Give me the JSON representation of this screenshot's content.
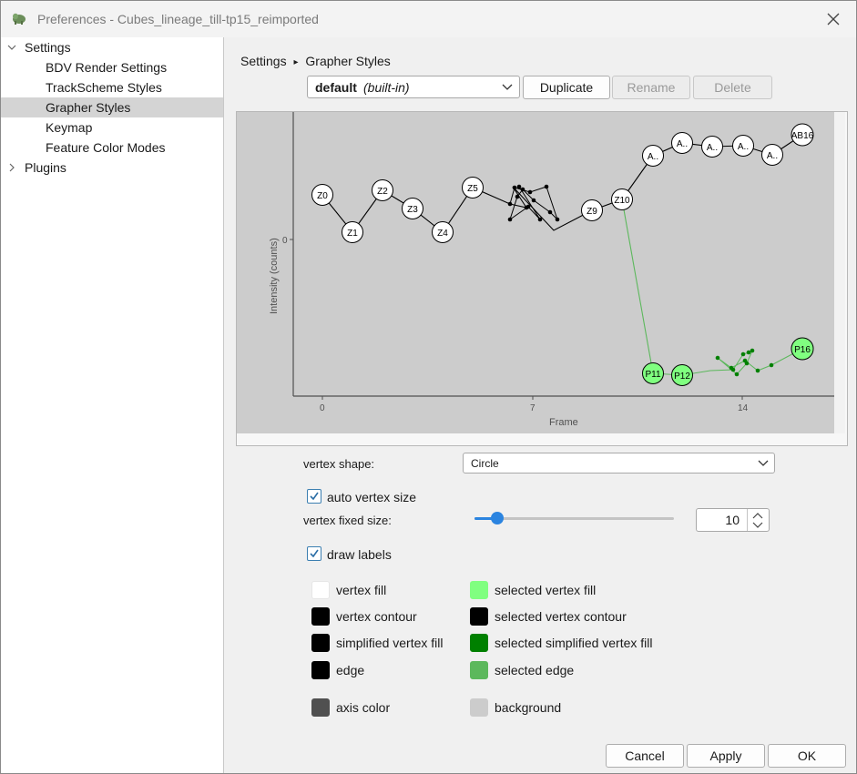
{
  "window": {
    "title": "Preferences - Cubes_lineage_till-tp15_reimported"
  },
  "sidebar": {
    "items": [
      {
        "label": "Settings"
      },
      {
        "label": "BDV Render Settings"
      },
      {
        "label": "TrackScheme Styles"
      },
      {
        "label": "Grapher Styles",
        "selected": true
      },
      {
        "label": "Keymap"
      },
      {
        "label": "Feature Color Modes"
      },
      {
        "label": "Plugins"
      }
    ]
  },
  "breadcrumb": {
    "root": "Settings",
    "separator": "▸",
    "current": "Grapher Styles"
  },
  "style_selector": {
    "name": "default",
    "suffix": "(built-in)"
  },
  "buttons": {
    "duplicate": "Duplicate",
    "rename": "Rename",
    "delete": "Delete"
  },
  "preview": {
    "ylabel": "Intensity (counts)",
    "xlabel": "Frame",
    "xticks": [
      "0",
      "7",
      "14"
    ],
    "ytick": "0",
    "vertices_top": [
      "Z0",
      "Z1",
      "Z2",
      "Z3",
      "Z4",
      "Z5",
      "Z9",
      "Z10",
      "A..",
      "A..",
      "A..",
      "A..",
      "A..",
      "AB16"
    ],
    "vertices_selected": [
      "P11",
      "P12",
      "P16"
    ]
  },
  "options": {
    "vertex_shape_label": "vertex shape:",
    "vertex_shape_value": "Circle",
    "auto_vertex_size_label": "auto vertex size",
    "auto_vertex_size": true,
    "vertex_fixed_size_label": "vertex fixed size:",
    "vertex_fixed_size": "10",
    "slider_fraction": 0.09,
    "draw_labels_label": "draw labels",
    "draw_labels": true
  },
  "colors": {
    "left": [
      {
        "label": "vertex fill",
        "color": "#ffffff"
      },
      {
        "label": "vertex contour",
        "color": "#000000"
      },
      {
        "label": "simplified vertex fill",
        "color": "#000000"
      },
      {
        "label": "edge",
        "color": "#000000"
      },
      {
        "label": "axis color",
        "color": "#505050"
      }
    ],
    "right": [
      {
        "label": "selected vertex fill",
        "color": "#80ff80"
      },
      {
        "label": "selected vertex contour",
        "color": "#000000"
      },
      {
        "label": "selected simplified vertex fill",
        "color": "#008000"
      },
      {
        "label": "selected edge",
        "color": "#5cb85c"
      },
      {
        "label": "background",
        "color": "#cccccc"
      }
    ]
  },
  "footer": {
    "cancel": "Cancel",
    "apply": "Apply",
    "ok": "OK"
  }
}
